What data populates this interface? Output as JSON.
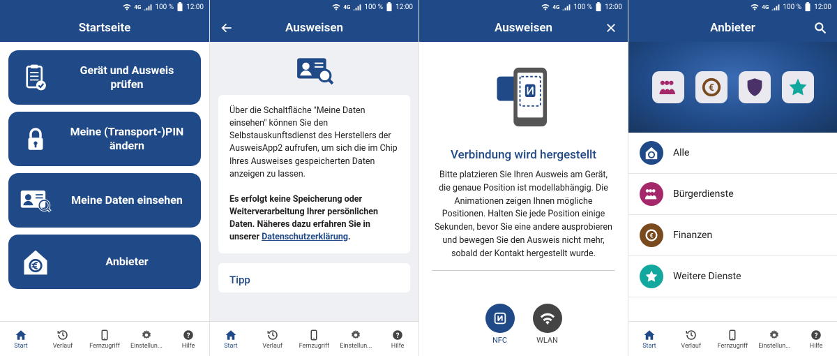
{
  "status": {
    "time": "12:00",
    "battery": "100 %",
    "net": "4G"
  },
  "nav": {
    "start": "Start",
    "verlauf": "Verlauf",
    "fernzugriff": "Fernzugriff",
    "einstellungen": "Einstellun...",
    "hilfe": "Hilfe"
  },
  "screen1": {
    "title": "Startseite",
    "btn1": "Gerät und Ausweis prüfen",
    "btn2": "Meine (Transport-)PIN ändern",
    "btn3": "Meine Daten einsehen",
    "btn4": "Anbieter"
  },
  "screen2": {
    "title": "Ausweisen",
    "para1": "Über die Schaltfläche \"Meine Daten einsehen\" können Sie den Selbstauskunftsdienst des Herstellers der AusweisApp2 aufrufen, um sich die im Chip Ihres Ausweises gespeicherten Daten anzeigen zu lassen.",
    "para2a": "Es erfolgt keine Speicherung oder Weiterverarbeitung Ihrer persönlichen Daten. Näheres dazu erfahren Sie in unserer ",
    "para2link": "Datenschutzerklärung",
    "tipp": "Tipp"
  },
  "screen3": {
    "title": "Ausweisen",
    "heading": "Verbindung wird hergestellt",
    "body": "Bitte platzieren Sie Ihren Ausweis am Gerät, die genaue Position ist modellabhängig. Die Animationen zeigen Ihnen mögliche Positionen. Halten Sie jede Position einige Sekunden, bevor Sie eine andere ausprobieren und bewegen Sie den Ausweis nicht mehr, sobald der Kontakt hergestellt wurde.",
    "nfc": "NFC",
    "wlan": "WLAN"
  },
  "screen4": {
    "title": "Anbieter",
    "rows": {
      "alle": "Alle",
      "buerger": "Bürgerdienste",
      "finanzen": "Finanzen",
      "weitere": "Weitere Dienste"
    }
  },
  "colors": {
    "brand": "#204a87",
    "magenta": "#a4286a",
    "brown": "#7a4a1f",
    "purple": "#4a3268",
    "teal": "#13a89e"
  }
}
